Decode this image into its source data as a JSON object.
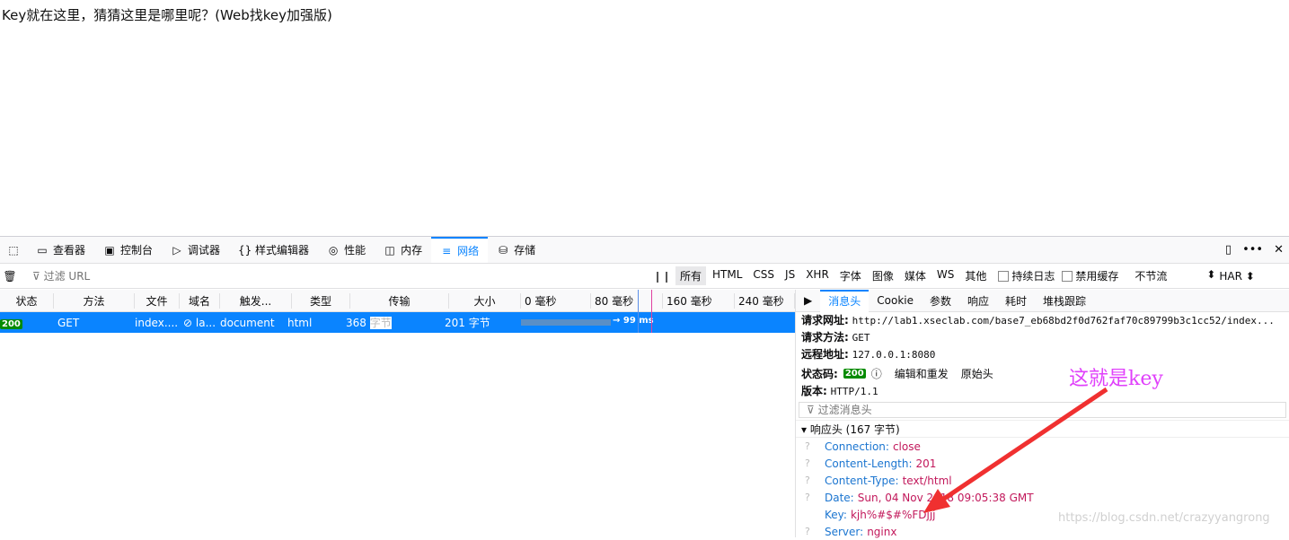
{
  "page": {
    "text": "Key就在这里，猜猜这里是哪里呢？(Web找key加强版)"
  },
  "toolbar": {
    "tabs": [
      {
        "label": "查看器",
        "icon": "inspector-icon"
      },
      {
        "label": "控制台",
        "icon": "console-icon"
      },
      {
        "label": "调试器",
        "icon": "debugger-icon"
      },
      {
        "label": "样式编辑器",
        "icon": "style-editor-icon"
      },
      {
        "label": "性能",
        "icon": "performance-icon"
      },
      {
        "label": "内存",
        "icon": "memory-icon"
      },
      {
        "label": "网络",
        "icon": "network-icon",
        "active": true
      },
      {
        "label": "存储",
        "icon": "storage-icon"
      }
    ]
  },
  "filterbar": {
    "placeholder": "过滤 URL",
    "types": [
      "所有",
      "HTML",
      "CSS",
      "JS",
      "XHR",
      "字体",
      "图像",
      "媒体",
      "WS",
      "其他"
    ],
    "persist_label": "持续日志",
    "disable_cache_label": "禁用缓存",
    "throttle_label": "不节流",
    "har_label": "HAR"
  },
  "columns": [
    "状态",
    "方法",
    "文件",
    "域名",
    "触发...",
    "类型",
    "传输",
    "大小",
    "0 毫秒",
    "80 毫秒",
    "160 毫秒",
    "240 毫秒"
  ],
  "request": {
    "status": "200",
    "method": "GET",
    "file": "index....",
    "domain": "la...",
    "cause": "document",
    "type": "html",
    "transferred_num": "368",
    "transferred_unit": "字节",
    "size": "201 字节",
    "timing": "→ 99 ms"
  },
  "details": {
    "tabs": [
      "消息头",
      "Cookie",
      "参数",
      "响应",
      "耗时",
      "堆栈跟踪"
    ],
    "url_label": "请求网址:",
    "url": "http://lab1.xseclab.com/base7_eb68bd2f0d762faf70c89799b3c1cc52/index...",
    "method_label": "请求方法:",
    "method": "GET",
    "remote_label": "远程地址:",
    "remote": "127.0.0.1:8080",
    "status_label": "状态码:",
    "status": "200",
    "edit_resend": "编辑和重发",
    "raw_headers": "原始头",
    "version_label": "版本:",
    "version": "HTTP/1.1",
    "filter_placeholder": "过滤消息头",
    "response_section": "响应头 (167 字节)",
    "headers": [
      {
        "name": "Connection:",
        "value": "close"
      },
      {
        "name": "Content-Length:",
        "value": "201"
      },
      {
        "name": "Content-Type:",
        "value": "text/html"
      },
      {
        "name": "Date:",
        "value": "Sun, 04 Nov 2018 09:05:38 GMT"
      },
      {
        "name": "Key:",
        "value": "kjh%#$#%FDjjj"
      },
      {
        "name": "Server:",
        "value": "nginx"
      }
    ]
  },
  "annotation": {
    "text": "这就是key",
    "color": "#e040fb"
  },
  "watermark": "https://blog.csdn.net/crazyyangrong"
}
